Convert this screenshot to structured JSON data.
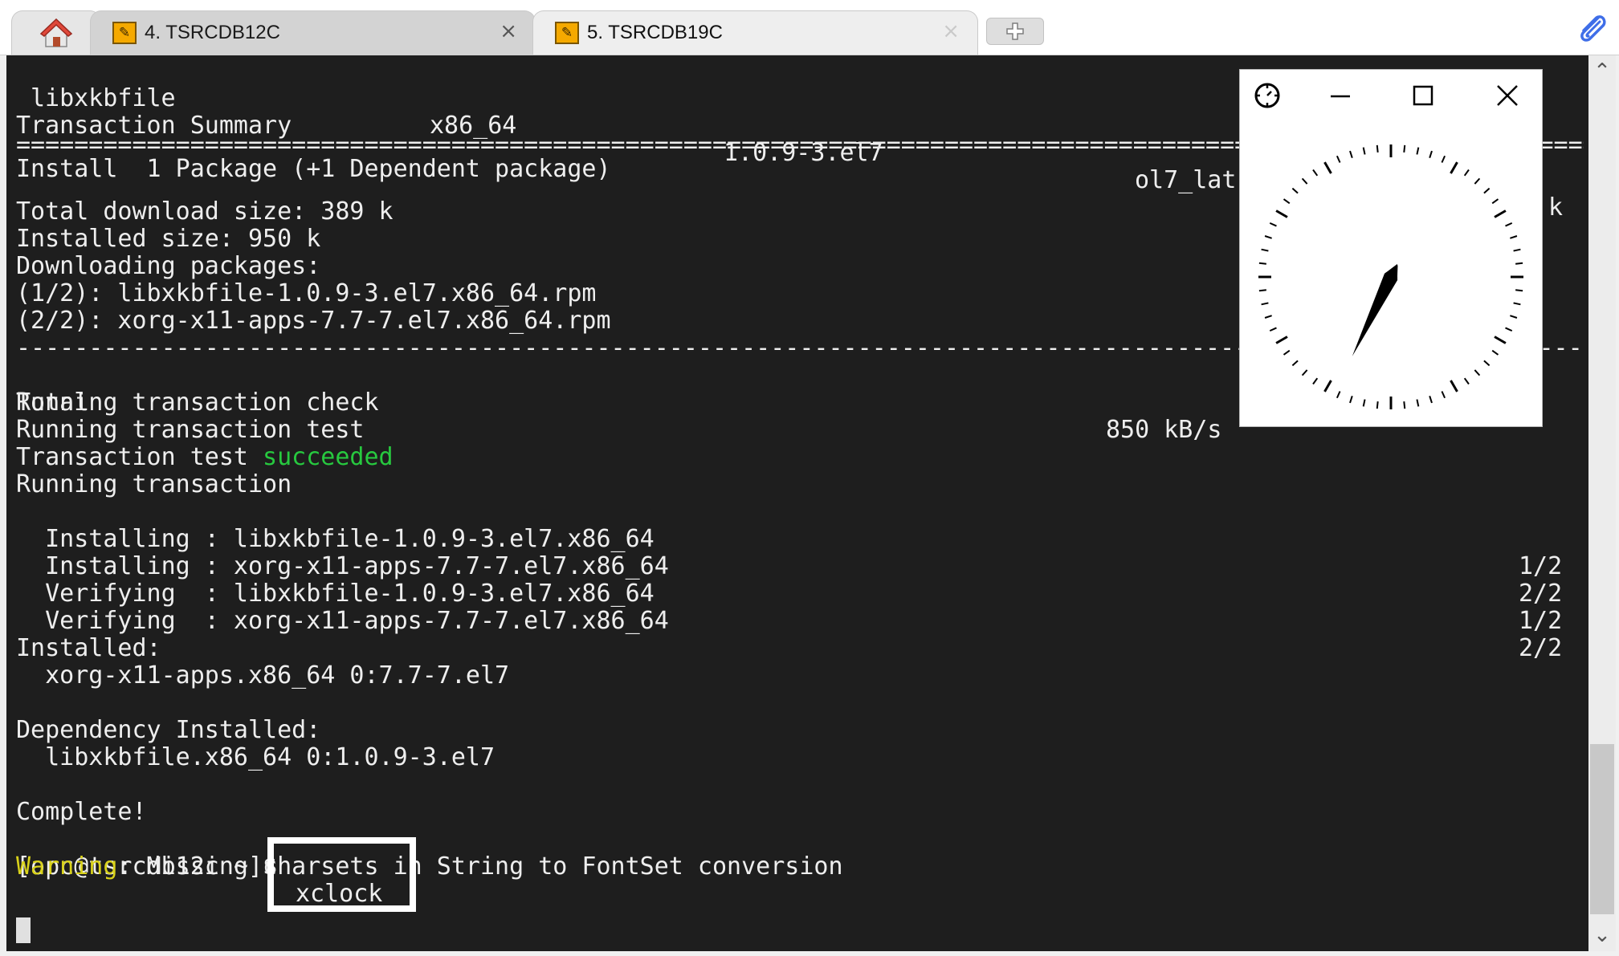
{
  "tabs": [
    {
      "label": "4. TSRCDB12C",
      "active": true
    },
    {
      "label": "5. TSRCDB19C",
      "active": false
    }
  ],
  "tab_close_glyph": "×",
  "terminal": {
    "header_row": {
      "name": "libxkbfile",
      "arch": "x86_64",
      "version": "1.0.9-3.el7",
      "repo": "ol7_lat",
      "size": "k"
    },
    "transaction_summary": "Transaction Summary",
    "double_separator": "==============================================================================================================================================",
    "install_line": "Install  1 Package (+1 Dependent package)",
    "total_download": "Total download size: 389 k",
    "installed_size": "Installed size: 950 k",
    "downloading": "Downloading packages:",
    "dl_1": "(1/2): libxkbfile-1.0.9-3.el7.x86_64.rpm",
    "dl_2": "(2/2): xorg-x11-apps-7.7-7.el7.x86_64.rpm",
    "dash_separator": "----------------------------------------------------------------------------------------------------------------------------------------------",
    "total_label": "Total",
    "total_speed": "850 kB/s",
    "running_check": "Running transaction check",
    "running_test": "Running transaction test",
    "test_prefix": "Transaction test ",
    "test_status": "succeeded",
    "running_transaction": "Running transaction",
    "steps": [
      {
        "action": "  Installing : libxkbfile-1.0.9-3.el7.x86_64",
        "progress": "1/2"
      },
      {
        "action": "  Installing : xorg-x11-apps-7.7-7.el7.x86_64",
        "progress": "2/2"
      },
      {
        "action": "  Verifying  : libxkbfile-1.0.9-3.el7.x86_64",
        "progress": "1/2"
      },
      {
        "action": "  Verifying  : xorg-x11-apps-7.7-7.el7.x86_64",
        "progress": "2/2"
      }
    ],
    "installed_label": "Installed:",
    "installed_pkg": "  xorg-x11-apps.x86_64 0:7.7-7.el7",
    "dependency_label": "Dependency Installed:",
    "dependency_pkg": "  libxkbfile.x86_64 0:1.0.9-3.el7",
    "complete": "Complete!",
    "prompt": "[opc@tsrcdb12c ~]$",
    "command": "xclock",
    "warning_label": "Warning",
    "warning_text": ": Missing charsets in String to FontSet conversion"
  },
  "xclock": {
    "hour_hand_angle_deg": 30,
    "minute_hand_angle_deg": 206
  },
  "colors": {
    "terminal_bg": "#1e1e1e",
    "terminal_fg": "#eeeeee",
    "success": "#27c93f",
    "warning": "#d9d21a"
  }
}
